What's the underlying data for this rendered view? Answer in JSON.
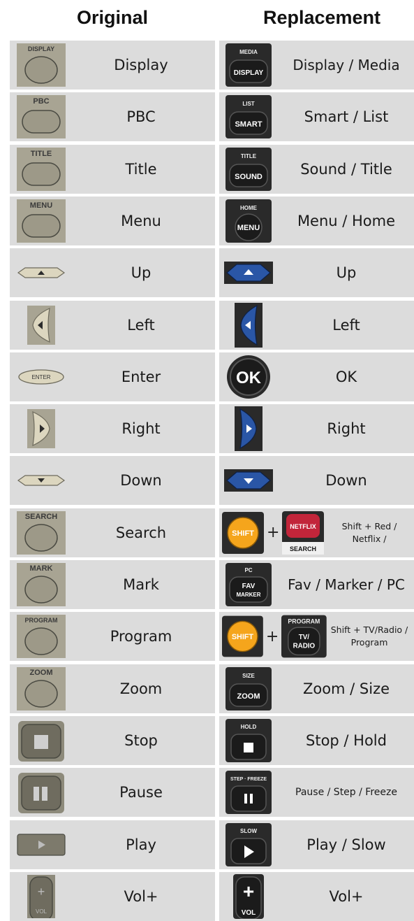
{
  "headers": {
    "original": "Original",
    "replacement": "Replacement"
  },
  "rows": [
    {
      "original": "Display",
      "replacement": "Display / Media",
      "orig_icon": "display-button-icon",
      "repl_icon": "display-media-button-icon"
    },
    {
      "original": "PBC",
      "replacement": "Smart / List",
      "orig_icon": "pbc-button-icon",
      "repl_icon": "smart-list-button-icon"
    },
    {
      "original": "Title",
      "replacement": "Sound / Title",
      "orig_icon": "title-button-icon",
      "repl_icon": "sound-title-button-icon"
    },
    {
      "original": "Menu",
      "replacement": "Menu / Home",
      "orig_icon": "menu-button-icon",
      "repl_icon": "menu-home-button-icon"
    },
    {
      "original": "Up",
      "replacement": "Up",
      "orig_icon": "up-arrow-icon",
      "repl_icon": "up-arrow-blue-icon"
    },
    {
      "original": "Left",
      "replacement": "Left",
      "orig_icon": "left-arrow-icon",
      "repl_icon": "left-arrow-blue-icon"
    },
    {
      "original": "Enter",
      "replacement": "OK",
      "orig_icon": "enter-button-icon",
      "repl_icon": "ok-button-icon"
    },
    {
      "original": "Right",
      "replacement": "Right",
      "orig_icon": "right-arrow-icon",
      "repl_icon": "right-arrow-blue-icon"
    },
    {
      "original": "Down",
      "replacement": "Down",
      "orig_icon": "down-arrow-icon",
      "repl_icon": "down-arrow-blue-icon"
    },
    {
      "original": "Search",
      "replacement": "Shift + Red / Netflix /",
      "orig_icon": "search-button-icon",
      "repl_icon": "shift-netflix-combo-icon"
    },
    {
      "original": "Mark",
      "replacement": "Fav / Marker / PC",
      "orig_icon": "mark-button-icon",
      "repl_icon": "fav-marker-button-icon"
    },
    {
      "original": "Program",
      "replacement": "Shift + TV/Radio / Program",
      "orig_icon": "program-button-icon",
      "repl_icon": "shift-tv-radio-combo-icon"
    },
    {
      "original": "Zoom",
      "replacement": "Zoom / Size",
      "orig_icon": "zoom-button-icon",
      "repl_icon": "zoom-size-button-icon"
    },
    {
      "original": "Stop",
      "replacement": "Stop / Hold",
      "orig_icon": "stop-button-icon",
      "repl_icon": "stop-hold-button-icon"
    },
    {
      "original": "Pause",
      "replacement": "Pause / Step / Freeze",
      "orig_icon": "pause-button-icon",
      "repl_icon": "pause-step-freeze-button-icon"
    },
    {
      "original": "Play",
      "replacement": "Play / Slow",
      "orig_icon": "play-button-icon",
      "repl_icon": "play-slow-button-icon"
    },
    {
      "original": "Vol+",
      "replacement": "Vol+",
      "orig_icon": "vol-plus-button-icon",
      "repl_icon": "vol-plus-black-button-icon"
    }
  ],
  "button_labels": {
    "display": "DISPLAY",
    "pbc": "PBC",
    "title": "TITLE",
    "menu": "MENU",
    "enter": "ENTER",
    "search": "SEARCH",
    "mark": "MARK",
    "program": "PROGRAM",
    "zoom": "ZOOM",
    "vol": "VOL",
    "media": "MEDIA",
    "list": "LIST",
    "smart": "SMART",
    "sound": "SOUND",
    "home": "HOME",
    "ok": "OK",
    "shift": "SHIFT",
    "netflix": "NETFLIX",
    "pc": "PC",
    "fav": "FAV",
    "marker": "MARKER",
    "tv": "TV/",
    "radio": "RADIO",
    "size": "SIZE",
    "hold": "HOLD",
    "step_freeze": "STEP · FREEZE",
    "slow": "SLOW",
    "plus": "+"
  },
  "colors": {
    "cell": "#dcdcdc",
    "orig_button": "#a8a493",
    "repl_button": "#1b1b1b",
    "nav_blue": "#2a56a6",
    "shift_orange": "#f5a51c",
    "netflix_red": "#c2253a"
  }
}
